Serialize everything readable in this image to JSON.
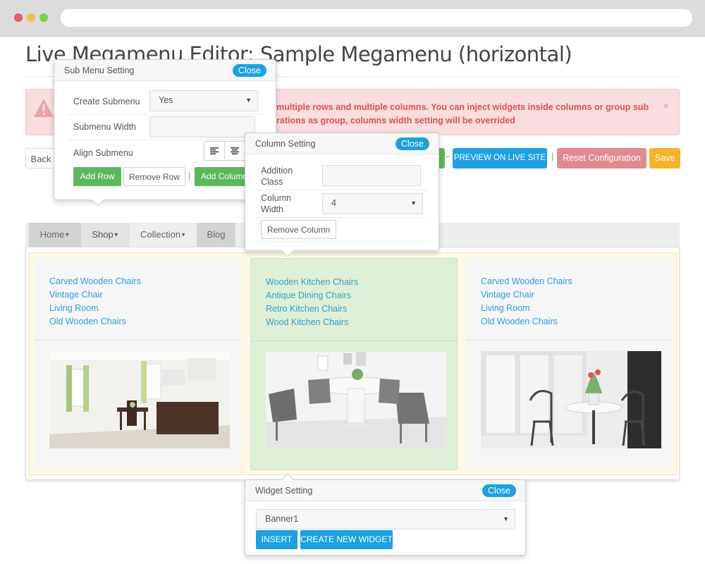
{
  "page": {
    "title": "Live Megamenu Editor: Sample Megamenu (horizontal)"
  },
  "alert": {
    "text": "multiple rows and multiple columns. You can inject widgets inside columns or group sub rations as group, columns width setting will be overrided",
    "line1": "multiple rows and multiple columns. You can inject widgets inside columns or group sub",
    "line2": "rations as group, columns width setting will be overrided",
    "close": "×"
  },
  "toolbar": {
    "back_label": "Back",
    "separator_dash": "-",
    "preview_label": "PREVIEW ON LIVE SITE",
    "separator_bar": "|",
    "reset_label": "Reset Configuration",
    "save_label": "Save"
  },
  "menu": {
    "items": [
      {
        "label": "Home",
        "caret": "▼"
      },
      {
        "label": "Shop",
        "caret": "▼"
      },
      {
        "label": "Collection",
        "caret": "▼"
      },
      {
        "label": "Blog"
      }
    ]
  },
  "columns": [
    {
      "links": [
        "Carved Wooden Chairs",
        "Vintage Chair",
        "Living Room",
        "Old Wooden Chairs"
      ]
    },
    {
      "links": [
        "Wooden Kitchen Chairs",
        "Antique Dining Chairs",
        "Retro Kitchen Chairs",
        "Wood Kitchen Chairs"
      ]
    },
    {
      "links": [
        "Carved Wooden Chairs",
        "Vintage Chair",
        "Living Room",
        "Old Wooden Chairs"
      ]
    }
  ],
  "submenu_setting": {
    "title": "Sub Menu Setting",
    "close_label": "Close",
    "create_submenu_label": "Create Submenu",
    "create_submenu_value": "Yes",
    "submenu_width_label": "Submenu Width",
    "submenu_width_value": "",
    "align_submenu_label": "Align Submenu",
    "add_row_label": "Add Row",
    "remove_row_label": "Remove Row",
    "separator": "|",
    "add_column_label": "Add Column"
  },
  "column_setting": {
    "title": "Column Setting",
    "close_label": "Close",
    "addition_class_label": "Addition Class",
    "addition_class_value": "",
    "column_width_label": "Column Width",
    "column_width_value": "4",
    "remove_column_label": "Remove Column"
  },
  "widget_setting": {
    "title": "Widget Setting",
    "close_label": "Close",
    "widget_value": "Banner1",
    "insert_label": "INSERT",
    "create_label": "CREATE NEW WIDGET"
  },
  "icons": {
    "select_arrow": "▼",
    "alert": "warning-icon"
  },
  "colors": {
    "accent_blue": "#1ba1e2",
    "green": "#5cb85c",
    "reset_red": "#e08a8f",
    "save_orange": "#f5b327",
    "link_blue": "#2a9fd6",
    "alert_bg": "#f9dde0",
    "alert_text": "#d9534f"
  }
}
